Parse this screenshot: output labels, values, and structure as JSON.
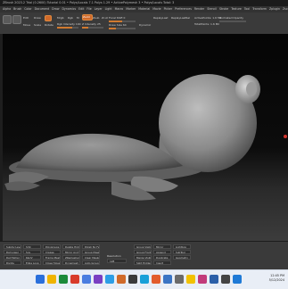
{
  "window": {
    "title": "ZBrush 2023.2 Trial (0.2600) Tutorial 0.01 • Polys/Locals 7.1 Polys 1.29 • ActivePolymesh 3 • Polys/Locals Total: 3"
  },
  "menu": [
    "Alpha",
    "Brush",
    "Color",
    "Document",
    "Draw",
    "Dynamics",
    "Edit",
    "File",
    "Layer",
    "Light",
    "Macro",
    "Marker",
    "Material",
    "Movie",
    "Picker",
    "Preferences",
    "Render",
    "Stencil",
    "Stroke",
    "Texture",
    "Tool",
    "Transform",
    "Zplugin",
    "Zscript",
    "Help"
  ],
  "toolbar": {
    "mode_edit": "Edit",
    "mode_draw": "Draw",
    "mode_move": "Move",
    "mode_scale": "Scale",
    "mode_rotate": "Rotate",
    "mrgb": "Mrgb",
    "rgb": "Rgb",
    "m": "M",
    "zadd": "Zadd",
    "zsub": "Zsub",
    "zcut": "Zcut",
    "focal_shift": "Focal Shift 0",
    "draw_size": "Draw Size 64",
    "dynamic": "Dynamic",
    "rgb_intensity": "Rgb Intensity 100",
    "z_intensity": "Z Intensity 25",
    "replay_last": "ReplayLast",
    "replay_last_rel": "ReplayLastRel",
    "active_points": "ActivePoints: 1.6 Mil",
    "total_points": "TotalPoints: 1.6 Mil",
    "animated_opacity": "Animated Opacity"
  },
  "bottom": {
    "buttons": [
      "Subdiv Levels",
      "Del Lower",
      "Del Higher",
      "Divide",
      "Smt",
      "Suv",
      "ReUV",
      "Edge Loop",
      "Polygroups",
      "Crease",
      "Frame Mesh",
      "Close Holes",
      "Delete Hidden",
      "Mirror And Weld",
      "ZRemesher",
      "Dynamesh",
      "Polish By Features",
      "Group Masked",
      "Clear Masked",
      "Auto Groups",
      "Group Visible",
      "Group Front",
      "Merge Visible",
      "Split Hidden",
      "Mirror",
      "Append",
      "Duplicate",
      "Insert",
      "Lightbox",
      "SubTool",
      "Geometry"
    ],
    "resolution_label": "Resolution",
    "resolution_value": "128"
  },
  "taskbar": {
    "time": "12:45 PM",
    "date": "5/12/2024",
    "icon_colors": [
      "#2a6fdb",
      "#f0b400",
      "#1b8a3a",
      "#d83b2b",
      "#4a7de0",
      "#7a3fc2",
      "#2c9ee6",
      "#d06a2a",
      "#3b3b3b",
      "#19a0d8",
      "#e25c2c",
      "#3a74c4",
      "#6a6a6a",
      "#f2c200",
      "#c23b7a",
      "#2b5fa8",
      "#444444",
      "#1f7ad6"
    ]
  },
  "status": {
    "accent": "#d06a2a",
    "viewport_bg": "#0a0a0a"
  }
}
